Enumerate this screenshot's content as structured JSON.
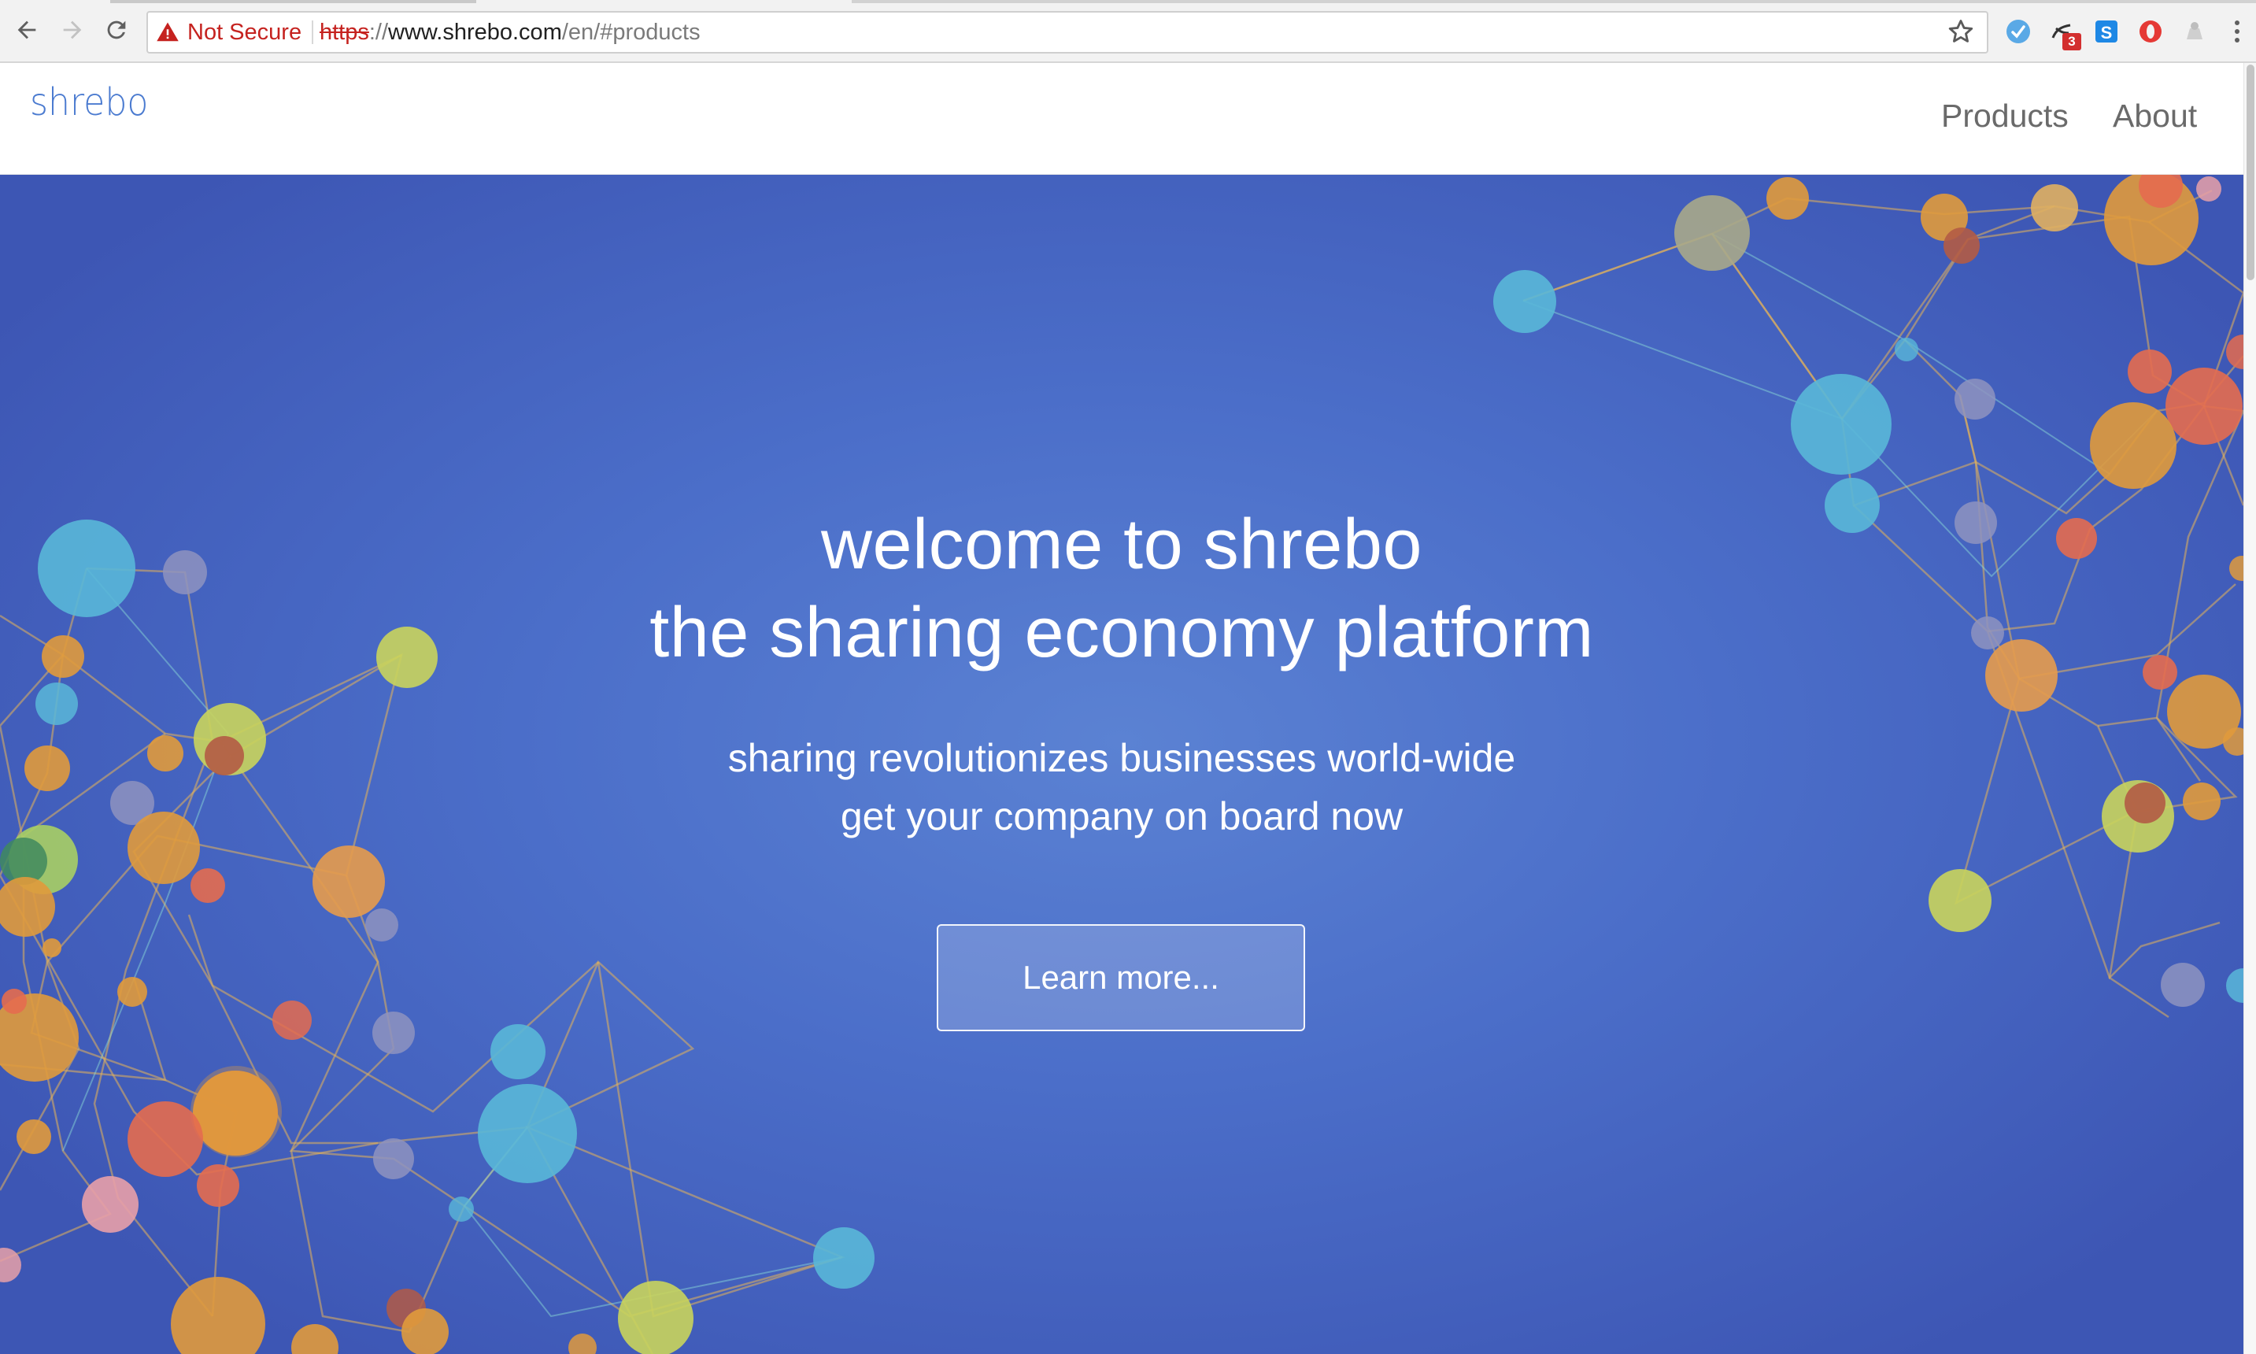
{
  "browser": {
    "security_label": "Not Secure",
    "url": {
      "scheme": "https",
      "separator": "://",
      "host": "www.shrebo.com",
      "path": "/en/#products"
    },
    "extensions": [
      "extension-1-icon",
      "extension-2-icon",
      "extension-3-icon",
      "opera-icon",
      "extension-5-icon"
    ],
    "extension_badge": "3",
    "colors": {
      "security": "#c5221f"
    }
  },
  "site": {
    "logo": "shrebo",
    "nav": {
      "products": "Products",
      "about": "About"
    },
    "colors": {
      "logo": "#4b7bd0",
      "hero_bg": "#4b6ec9",
      "hero_text": "#ffffff"
    }
  },
  "hero": {
    "title_line1": "welcome to shrebo",
    "title_line2": "the sharing economy platform",
    "subtitle_line1": "sharing revolutionizes businesses world-wide",
    "subtitle_line2": "get your company on board now",
    "cta_label": "Learn more..."
  }
}
